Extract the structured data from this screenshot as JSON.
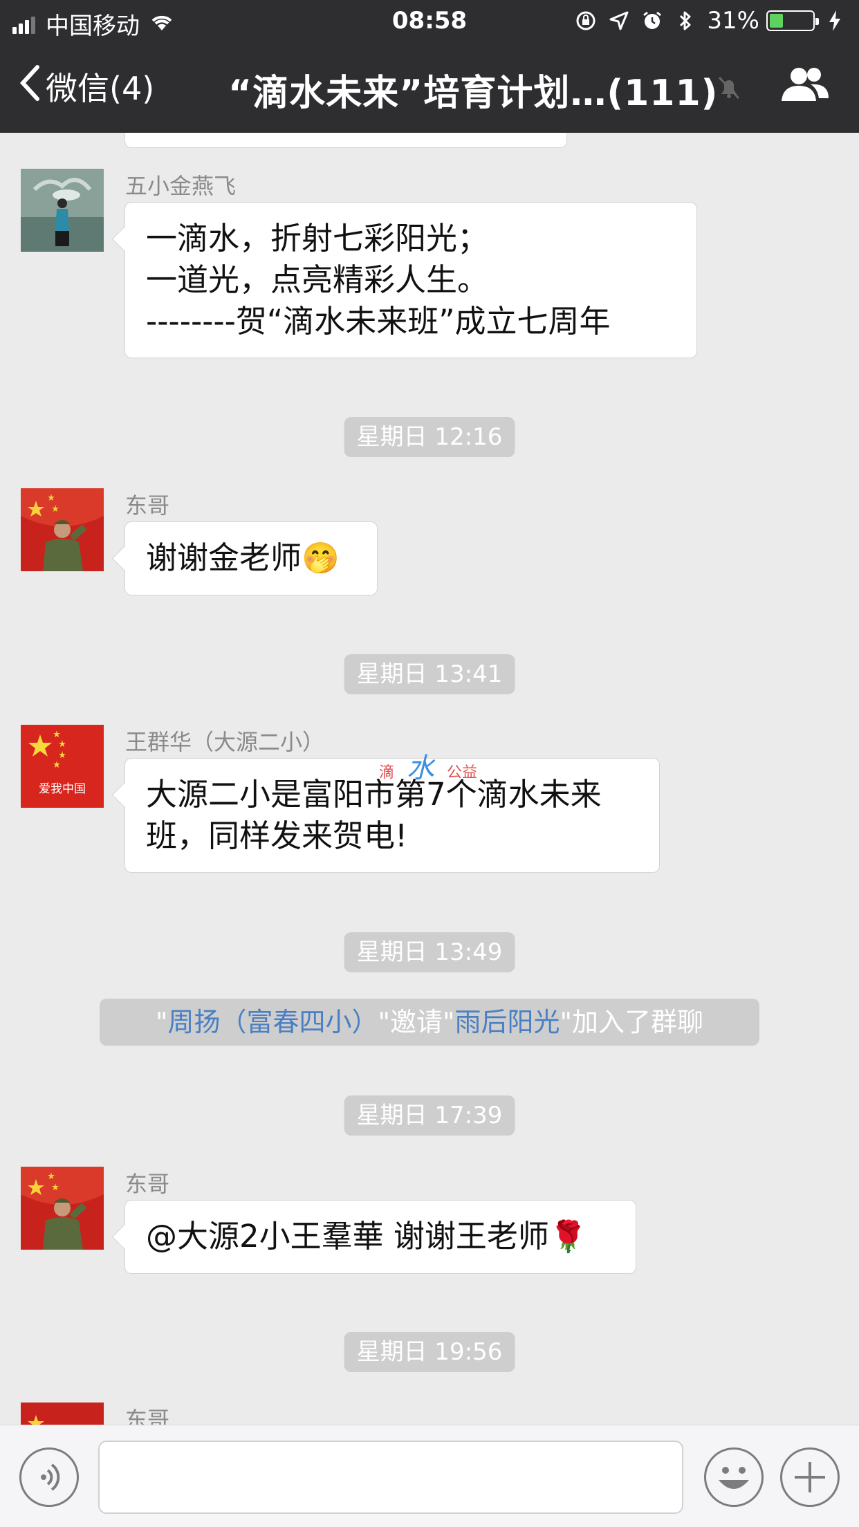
{
  "status_bar": {
    "carrier": "中国移动",
    "time": "08:58",
    "battery": "31%",
    "battery_level": 0.31
  },
  "nav": {
    "back_label": "微信(4)",
    "title": "“滴水未来”培育计划…(111)"
  },
  "watermark": {
    "left": "滴",
    "right": "公益"
  },
  "messages": [
    {
      "sender": "五小金燕飞",
      "lines": [
        "一滴水，折射七彩阳光；",
        "一道光，点亮精彩人生。",
        "--------贺“滴水未来班”成立七周年"
      ]
    },
    {
      "time": "星期日 12:16"
    },
    {
      "sender": "东哥",
      "text": "谢谢金老师",
      "emoji": "🤭"
    },
    {
      "time": "星期日 13:41"
    },
    {
      "sender": "王群华（大源二小）",
      "lines": [
        "大源二小是富阳市第7个滴水未来",
        "班，同样发来贺电!"
      ]
    },
    {
      "time": "星期日 13:49"
    },
    {
      "system": {
        "q1": "\"",
        "inviter": "周扬（富春四小）",
        "mid": "\"邀请\"",
        "invitee": "雨后阳光",
        "tail": "\"加入了群聊"
      }
    },
    {
      "time": "星期日 17:39"
    },
    {
      "sender": "东哥",
      "text": "@大源2小王羣華 谢谢王老师",
      "emoji": "🌹"
    },
    {
      "time": "星期日 19:56"
    },
    {
      "sender": "东哥"
    }
  ],
  "input": {
    "placeholder": ""
  },
  "icons": {
    "back": "chevron-left-icon",
    "mute": "bell-slash-icon",
    "group": "group-people-icon",
    "voice": "voice-icon",
    "emoji": "smiley-icon",
    "plus": "plus-icon"
  }
}
